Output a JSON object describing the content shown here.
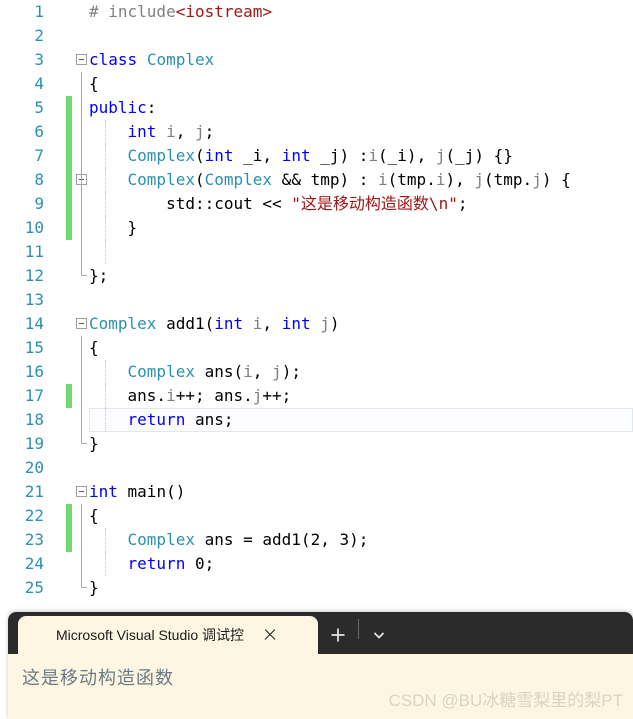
{
  "editor": {
    "language": "cpp",
    "current_line": 18,
    "change_bar_color": "#6FDB6F",
    "line_number_color": "#2B91AF",
    "lines": [
      {
        "n": "1",
        "text": "# include<iostream>"
      },
      {
        "n": "2",
        "text": ""
      },
      {
        "n": "3",
        "text": "class Complex"
      },
      {
        "n": "4",
        "text": "{"
      },
      {
        "n": "5",
        "text": "public:"
      },
      {
        "n": "6",
        "text": "    int i, j;"
      },
      {
        "n": "7",
        "text": "    Complex(int _i, int _j) :i(_i), j(_j) {}"
      },
      {
        "n": "8",
        "text": "    Complex(Complex && tmp) : i(tmp.i), j(tmp.j) {"
      },
      {
        "n": "9",
        "text": "        std::cout << \"这是移动构造函数\\n\";"
      },
      {
        "n": "10",
        "text": "    }"
      },
      {
        "n": "11",
        "text": ""
      },
      {
        "n": "12",
        "text": "};"
      },
      {
        "n": "13",
        "text": ""
      },
      {
        "n": "14",
        "text": "Complex add1(int i, int j)"
      },
      {
        "n": "15",
        "text": "{"
      },
      {
        "n": "16",
        "text": "    Complex ans(i, j);"
      },
      {
        "n": "17",
        "text": "    ans.i++; ans.j++;"
      },
      {
        "n": "18",
        "text": "    return ans;"
      },
      {
        "n": "19",
        "text": "}"
      },
      {
        "n": "20",
        "text": ""
      },
      {
        "n": "21",
        "text": "int main()"
      },
      {
        "n": "22",
        "text": "{"
      },
      {
        "n": "23",
        "text": "    Complex ans = add1(2, 3);"
      },
      {
        "n": "24",
        "text": "    return 0;"
      },
      {
        "n": "25",
        "text": "}"
      }
    ]
  },
  "terminal": {
    "tab": {
      "title": "Microsoft Visual Studio 调试控",
      "icon": "console-icon",
      "close_label": "×"
    },
    "new_tab_label": "+",
    "dropdown_label": "⌄",
    "output": "这是移动构造函数",
    "background": "#FDF6E3",
    "titlebar_background": "#2B2B2B"
  },
  "watermark": {
    "text": "CSDN @BU冰糖雪梨里的梨PT"
  }
}
